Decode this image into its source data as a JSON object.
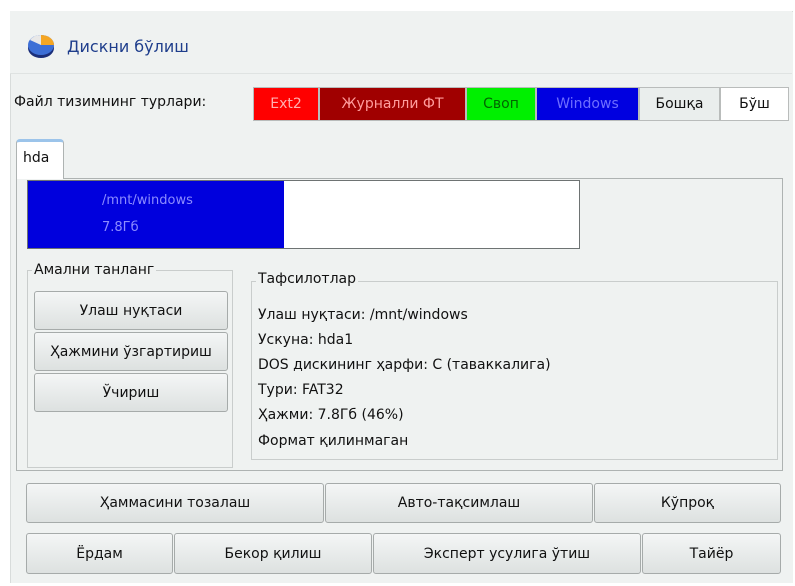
{
  "window": {
    "title": "Дискни бўлиш",
    "icon": "partition-pie-icon"
  },
  "filesystem_types": {
    "label": "Файл тизимнинг турлари:",
    "items": [
      {
        "label": "Ext2",
        "bg": "#ff0000",
        "fg": "#ffb0b0"
      },
      {
        "label": "Журналли ФТ",
        "bg": "#a00000",
        "fg": "#ff9d9d"
      },
      {
        "label": "Своп",
        "bg": "#00f000",
        "fg": "#006600"
      },
      {
        "label": "Windows",
        "bg": "#0000e0",
        "fg": "#6e6eff"
      },
      {
        "label": "Бошқа",
        "bg": "#eaeeed",
        "fg": "#111111"
      },
      {
        "label": "Бўш",
        "bg": "#ffffff",
        "fg": "#111111"
      }
    ]
  },
  "disk_tab": {
    "label": "hda"
  },
  "partitions": {
    "windows": {
      "mount": "/mnt/windows",
      "size": "7.8Гб"
    }
  },
  "actions": {
    "title": "Амални танланг",
    "buttons": [
      "Улаш нуқтаси",
      "Ҳажмини ўзгартириш",
      "Ўчириш"
    ]
  },
  "details": {
    "title": "Тафсилотлар",
    "lines": [
      "Улаш нуқтаси: /mnt/windows",
      "Ускуна: hda1",
      "DOS дискининг ҳарфи: C (таваккалига)",
      "Тури: FAT32",
      "Ҳажми: 7.8Гб (46%)",
      "Формат қилинмаган"
    ]
  },
  "bottom_row1": [
    "Ҳаммасини тозалаш",
    "Авто-тақсимлаш",
    "Кўпроқ"
  ],
  "bottom_row2": [
    "Ёрдам",
    "Бекор қилиш",
    "Эксперт усулига ўтиш",
    "Тайёр"
  ],
  "colors": {
    "accent": "#1f3e8c",
    "windows_partition": "#0000dd"
  }
}
